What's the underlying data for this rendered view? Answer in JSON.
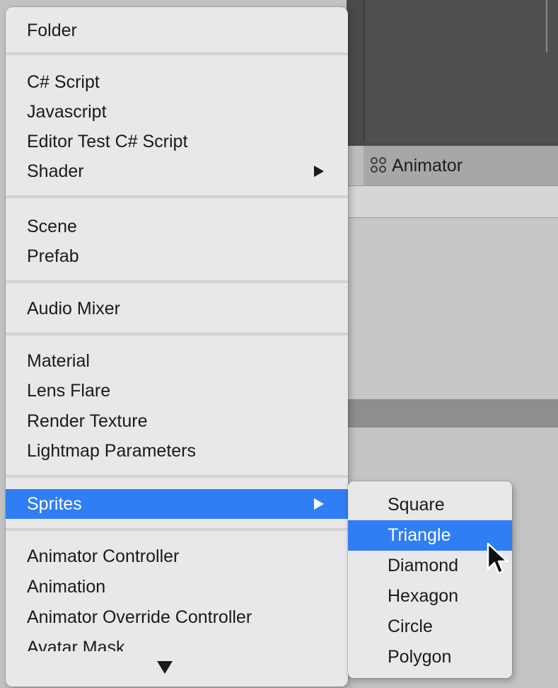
{
  "background": {
    "animator_tab_label": "Animator"
  },
  "main_menu": {
    "items": [
      {
        "label": "Folder"
      },
      {
        "label": "C# Script"
      },
      {
        "label": "Javascript"
      },
      {
        "label": "Editor Test C# Script"
      },
      {
        "label": "Shader",
        "has_submenu": true
      },
      {
        "label": "Scene"
      },
      {
        "label": "Prefab"
      },
      {
        "label": "Audio Mixer"
      },
      {
        "label": "Material"
      },
      {
        "label": "Lens Flare"
      },
      {
        "label": "Render Texture"
      },
      {
        "label": "Lightmap Parameters"
      },
      {
        "label": "Sprites",
        "has_submenu": true,
        "highlighted": true
      },
      {
        "label": "Animator Controller"
      },
      {
        "label": "Animation"
      },
      {
        "label": "Animator Override Controller"
      },
      {
        "label": "Avatar Mask"
      }
    ],
    "scroll_indicator_icon": "triangle-down-icon"
  },
  "sprites_submenu": {
    "items": [
      {
        "label": "Square"
      },
      {
        "label": "Triangle",
        "highlighted": true
      },
      {
        "label": "Diamond"
      },
      {
        "label": "Hexagon"
      },
      {
        "label": "Circle"
      },
      {
        "label": "Polygon"
      }
    ]
  },
  "colors": {
    "highlight": "#2f7ef3",
    "menu_background": "#e8e8e8",
    "separator": "#d3d3d3"
  }
}
